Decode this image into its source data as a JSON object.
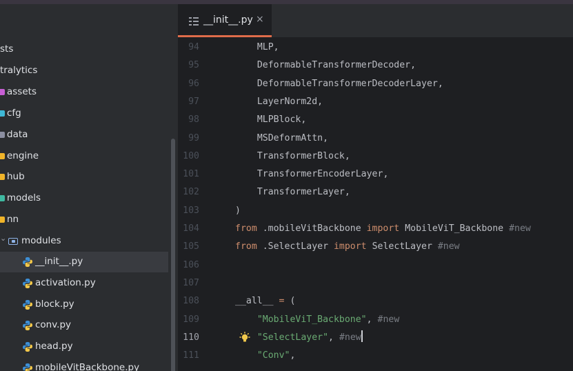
{
  "tab": {
    "label": "__init__.py",
    "close": "×"
  },
  "project_tree": [
    {
      "label": "sts",
      "kind": "text"
    },
    {
      "label": "tralytics",
      "kind": "text"
    },
    {
      "label": "assets",
      "kind": "folder",
      "color": "#c75fd4"
    },
    {
      "label": "cfg",
      "kind": "folder-gear",
      "color": "#3fb8d6"
    },
    {
      "label": "data",
      "kind": "folder",
      "color": "#8c8fa1"
    },
    {
      "label": "engine",
      "kind": "folder",
      "color": "#f0b429"
    },
    {
      "label": "hub",
      "kind": "folder",
      "color": "#f0b429"
    },
    {
      "label": "models",
      "kind": "folder",
      "color": "#3fb8a0"
    },
    {
      "label": "nn",
      "kind": "folder",
      "color": "#f0b429"
    },
    {
      "label": "modules",
      "kind": "folder-open",
      "chevron": "⌄"
    },
    {
      "label": "__init__.py",
      "kind": "python",
      "selected": true
    },
    {
      "label": "activation.py",
      "kind": "python"
    },
    {
      "label": "block.py",
      "kind": "python"
    },
    {
      "label": "conv.py",
      "kind": "python"
    },
    {
      "label": "head.py",
      "kind": "python"
    },
    {
      "label": "mobileVitBackbone.py",
      "kind": "python"
    }
  ],
  "editor": {
    "current_line": "110",
    "lines": [
      {
        "num": "94",
        "text": "    MLP,"
      },
      {
        "num": "95",
        "text": "    DeformableTransformerDecoder,"
      },
      {
        "num": "96",
        "text": "    DeformableTransformerDecoderLayer,"
      },
      {
        "num": "97",
        "text": "    LayerNorm2d,"
      },
      {
        "num": "98",
        "text": "    MLPBlock,"
      },
      {
        "num": "99",
        "text": "    MSDeformAttn,"
      },
      {
        "num": "100",
        "text": "    TransformerBlock,"
      },
      {
        "num": "101",
        "text": "    TransformerEncoderLayer,"
      },
      {
        "num": "102",
        "text": "    TransformerLayer,"
      },
      {
        "num": "103",
        "text": ")"
      },
      {
        "num": "104",
        "text": "from .mobileVitBackbone import MobileViT_Backbone #new"
      },
      {
        "num": "105",
        "text": "from .SelectLayer import SelectLayer #new"
      },
      {
        "num": "106",
        "text": ""
      },
      {
        "num": "107",
        "text": ""
      },
      {
        "num": "108",
        "text": "__all__ = ("
      },
      {
        "num": "109",
        "text": "    \"MobileViT_Backbone\", #new"
      },
      {
        "num": "110",
        "text": "    \"SelectLayer\", #new"
      },
      {
        "num": "111",
        "text": "    \"Conv\","
      }
    ],
    "syntax": {
      "keyword": "#cf8e6d",
      "string": "#6aab73",
      "comment": "#7a7e85",
      "identifier": "#bcbec4"
    }
  },
  "icons": {
    "tab": "structure-icon",
    "python": "python-file-icon",
    "bulb": "intention-bulb-icon",
    "close": "close-icon"
  }
}
